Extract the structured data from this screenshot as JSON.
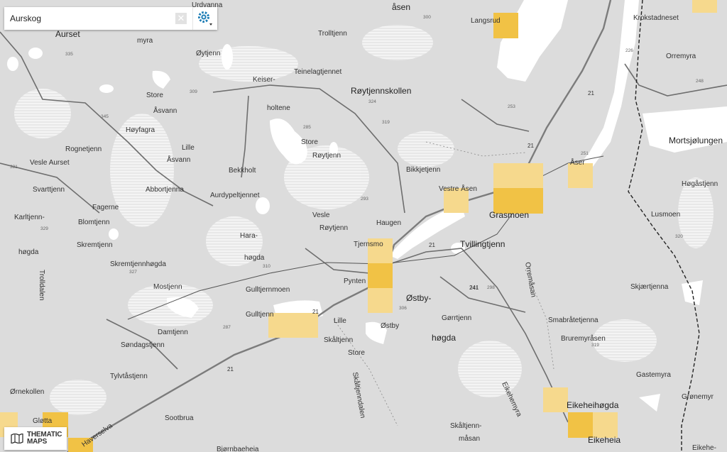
{
  "search": {
    "value": "Aurskog",
    "clear_symbol": "✕"
  },
  "thematic_maps": {
    "line1": "THEMATIC",
    "line2": "MAPS"
  },
  "place_names": [
    "Urdvanna",
    "Aurset",
    "myra",
    "Øytjenn",
    "Trolltjenn",
    "åsen",
    "Langsrud",
    "Krokstadneset",
    "Orremyra",
    "Keiser-",
    "Teinelagtjennet",
    "Store",
    "Røytjennskollen",
    "Åsvann",
    "Høyfagra",
    "holtene",
    "Rognetjenn",
    "Lille",
    "Store",
    "Åsvann",
    "Røytjenn",
    "Mortsjølungen",
    "Vesle Aurset",
    "Bekkholt",
    "Bikkjetjenn",
    "Åser",
    "Svarttjenn",
    "Abbortjenna",
    "Aurdypeltjennet",
    "Vestre Åsen",
    "Grasmoen",
    "Høgåstjenn",
    "Fagerne",
    "Karltjenn-",
    "Blomtjenn",
    "Vesle",
    "Haugen",
    "Lusmoen",
    "høgda",
    "Skremtjenn",
    "Hara-",
    "Røytjenn",
    "Tjernsmo",
    "Tvillingtjenn",
    "høgda",
    "Skremtjennhøgda",
    "Mostjenn",
    "Orremåsan",
    "Pynten",
    "Skjærtjenna",
    "Gulltjernmoen",
    "Østby-",
    "Gulltjenn",
    "Lille",
    "Gørrtjenn",
    "Smabråtetjenna",
    "Damtjenn",
    "Skåltjenn",
    "Østby",
    "høgda",
    "Bruremyråsen",
    "Søndagstjenn",
    "Store",
    "Tylvtåstjenn",
    "Gastemyra",
    "Ørnekollen",
    "Skåltjenndalen",
    "Sootbrua",
    "Eikehemyra",
    "Grønemyr",
    "Eikeheihøgda",
    "Gløtta",
    "Haverselva",
    "Trolldalen",
    "Skåltjenn-",
    "måsan",
    "Eikeheia",
    "Eikehe-",
    "Bjørnbaeheia"
  ],
  "elevations": [
    "335",
    "309",
    "300",
    "226",
    "248",
    "345",
    "285",
    "324",
    "319",
    "253",
    "331",
    "251",
    "293",
    "329",
    "327",
    "310",
    "298",
    "241",
    "306",
    "320",
    "287",
    "319"
  ],
  "road_numbers": [
    "21",
    "21",
    "21",
    "21",
    "21",
    "241"
  ],
  "colors": {
    "map_bg": "#dcdcdc",
    "water": "#ffffff",
    "highlight": "#f1c245",
    "highlight_light": "#f6d98d",
    "road": "#6e6e6e",
    "text": "#333333"
  },
  "icons": {
    "clear": "close-icon",
    "settings": "gear-icon",
    "thematic": "map-icon"
  }
}
